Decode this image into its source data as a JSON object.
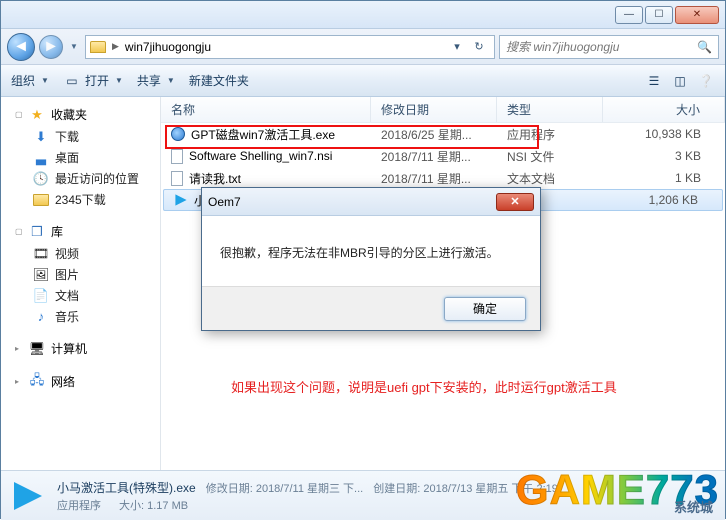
{
  "window": {
    "min": "—",
    "max": "☐",
    "close": "✕"
  },
  "nav": {
    "crumb": "win7jihuogongju",
    "search_placeholder": "搜索 win7jihuogongju"
  },
  "toolbar": {
    "organize": "组织",
    "open": "打开",
    "share": "共享",
    "newfolder": "新建文件夹"
  },
  "sidebar": {
    "favorites": "收藏夹",
    "fav_items": [
      "下载",
      "桌面",
      "最近访问的位置",
      "2345下载"
    ],
    "libraries": "库",
    "lib_items": [
      "视频",
      "图片",
      "文档",
      "音乐"
    ],
    "computer": "计算机",
    "network": "网络"
  },
  "columns": {
    "name": "名称",
    "date": "修改日期",
    "type": "类型",
    "size": "大小"
  },
  "files": [
    {
      "name": "GPT磁盘win7激活工具.exe",
      "date": "2018/6/25 星期...",
      "type": "应用程序",
      "size": "10,938 KB",
      "icon": "exe"
    },
    {
      "name": "Software Shelling_win7.nsi",
      "date": "2018/7/11 星期...",
      "type": "NSI 文件",
      "size": "3 KB",
      "icon": "nsi"
    },
    {
      "name": "请读我.txt",
      "date": "2018/7/11 星期...",
      "type": "文本文档",
      "size": "1 KB",
      "icon": "txt"
    },
    {
      "name": "小马",
      "date": "",
      "type": "",
      "size": "1,206 KB",
      "icon": "pma",
      "selected": true
    }
  ],
  "dialog": {
    "title": "Oem7",
    "message": "很抱歉，程序无法在非MBR引导的分区上进行激活。",
    "ok": "确定"
  },
  "annotation": "如果出现这个问题，说明是uefi gpt下安装的，此时运行gpt激活工具",
  "details": {
    "name": "小马激活工具(特殊型).exe",
    "type": "应用程序",
    "mod_label": "修改日期:",
    "mod": "2018/7/11 星期三 下...",
    "create_label": "创建日期:",
    "create": "2018/7/13 星期五 下午 2:19",
    "size_label": "大小:",
    "size": "1.17 MB"
  },
  "watermark": "GAME773",
  "watermark_sub": "系统城"
}
